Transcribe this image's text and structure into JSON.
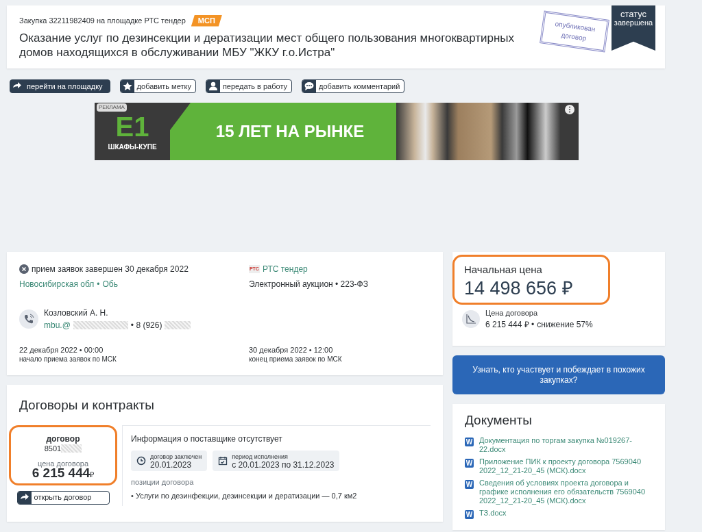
{
  "header": {
    "purchase_line": "Закупка 32211982409 на площадке РТС тендер",
    "badge": "МСП",
    "title": "Оказание услуг по дезинсекции и дератизации мест общего пользования многоквартирных домов находящихся в обслуживании МБУ \"ЖКУ г.о.Истра\"",
    "stamp": "опубликован договор",
    "status_label": "статус",
    "status_value": "завершена"
  },
  "actions": [
    {
      "label": "перейти на площадку",
      "kind": "primary"
    },
    {
      "label": "добавить метку",
      "kind": "star"
    },
    {
      "label": "передать в работу",
      "kind": "person"
    },
    {
      "label": "добавить комментарий",
      "kind": "comment"
    }
  ],
  "ad": {
    "tag": "РЕКЛАМА",
    "logo": "Е1",
    "logo_caption": "ШКАФЫ-КУПЕ",
    "slogan": "15 ЛЕТ НА РЫНКЕ"
  },
  "info": {
    "status": "прием заявок завершен 30 декабря 2022",
    "region": "Новосибирская обл",
    "separator": "•",
    "city": "Обь",
    "platform_logo": "РТС",
    "platform": "РТС тендер",
    "procedure": "Электронный аукцион • 223-ФЗ",
    "contact_name": "Козловский А. Н.",
    "email": "mbu.@",
    "phone": "• 8 (926)",
    "start_date": "22 декабря 2022 • 00:00",
    "start_label": "начало приема заявок по МСК",
    "end_date": "30 декабря 2022 • 12:00",
    "end_label": "конец приема заявок по МСК"
  },
  "contracts": {
    "title": "Договоры и контракты",
    "contract_label": "договор",
    "contract_number": "8501",
    "price_label": "цена договора",
    "price": "6 215 444",
    "currency": "₽",
    "open_button": "открыть договор",
    "supplier": "Информация о поставщике отсутствует",
    "concluded_label": "договор заключен",
    "concluded_date": "20.01.2023",
    "period_label": "период исполнения",
    "period": "с 20.01.2023 по 31.12.2023",
    "positions_label": "позиции договора",
    "positions": [
      "• Услуги по дезинфекции, дезинсекции и дератизации — 0,7 км2"
    ]
  },
  "price": {
    "label": "Начальная цена",
    "value": "14 498 656 ₽",
    "contract_label": "Цена договора",
    "contract_value": "6 215 444 ₽ •",
    "reduction": "снижение 57%"
  },
  "cta": "Узнать, кто участвует и побеждает в похожих закупках?",
  "documents": {
    "title": "Документы",
    "items": [
      {
        "icon": "W",
        "name": "Документация по торгам закупка №019267-22.docx"
      },
      {
        "icon": "W",
        "name": "Приложение ПИК к проекту договора 7569040 2022_12_21-20_45 (МСК).docx"
      },
      {
        "icon": "W",
        "name": "Сведения об условиях проекта договора и графике исполнения его обязательств 7569040 2022_12_21-20_45 (МСК).docx"
      },
      {
        "icon": "W",
        "name": "ТЗ.docx"
      }
    ]
  }
}
